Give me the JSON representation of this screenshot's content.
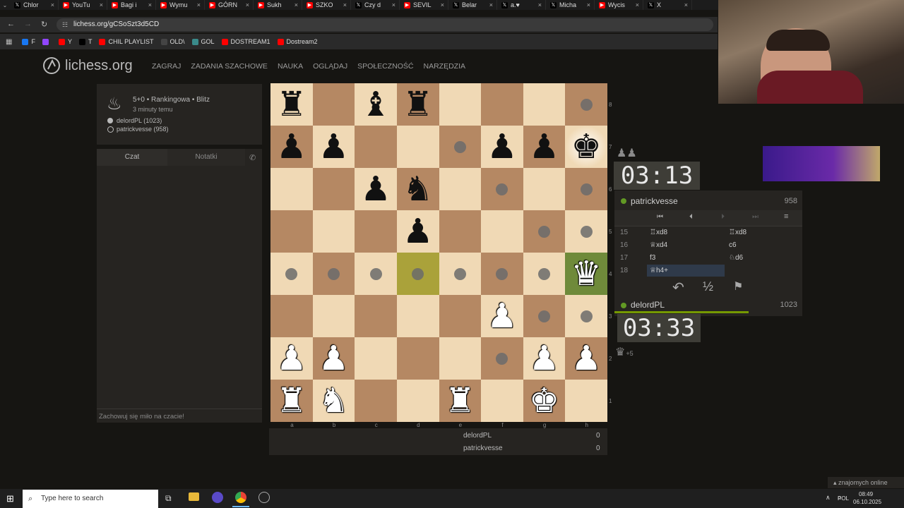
{
  "browser": {
    "tabs": [
      {
        "label": "Chlor",
        "icon": "x-icon",
        "color": "#000000"
      },
      {
        "label": "YouTu",
        "icon": "youtube-icon",
        "color": "#ff0000"
      },
      {
        "label": "Bagi i",
        "icon": "youtube-icon",
        "color": "#ff0000"
      },
      {
        "label": "Wymu",
        "icon": "youtube-icon",
        "color": "#ff0000"
      },
      {
        "label": "GÓRN",
        "icon": "youtube-icon",
        "color": "#ff0000"
      },
      {
        "label": "Sukh",
        "icon": "youtube-icon",
        "color": "#ff0000"
      },
      {
        "label": "SZKO",
        "icon": "youtube-icon",
        "color": "#ff0000"
      },
      {
        "label": "Czy d",
        "icon": "x-icon",
        "color": "#000000"
      },
      {
        "label": "SEVIL",
        "icon": "youtube-icon",
        "color": "#ff0000"
      },
      {
        "label": "Belar",
        "icon": "x-icon",
        "color": "#000000"
      },
      {
        "label": "a.♥",
        "icon": "x-icon",
        "color": "#000000"
      },
      {
        "label": "Micha",
        "icon": "x-icon",
        "color": "#000000"
      },
      {
        "label": "Wycis",
        "icon": "youtube-icon",
        "color": "#ff0000"
      },
      {
        "label": "X",
        "icon": "x-icon",
        "color": "#000000"
      }
    ],
    "url": "lichess.org/gCSoSzt3d5CD",
    "bookmarks": [
      {
        "label": "F",
        "color": "#1877f2"
      },
      {
        "label": "",
        "color": "#9146ff"
      },
      {
        "label": "Y",
        "color": "#ff0000"
      },
      {
        "label": "T",
        "color": "#000000"
      },
      {
        "label": "CHIL PLAYLIST",
        "color": "#ff0000"
      },
      {
        "label": "OLD\\",
        "color": "#444444"
      },
      {
        "label": "GOL",
        "color": "#3a8a8a"
      },
      {
        "label": "DOSTREAM1",
        "color": "#ff0000"
      },
      {
        "label": "Dostream2",
        "color": "#ff0000"
      }
    ]
  },
  "site": {
    "logo_text": "lichess.org",
    "nav": [
      "ZAGRAJ",
      "ZADANIA SZACHOWE",
      "NAUKA",
      "OGLĄDAJ",
      "SPOŁECZNOŚĆ",
      "NARZĘDZIA"
    ]
  },
  "game_info": {
    "format": "5+0 • Rankingowa • Blitz",
    "time_ago": "3 minuty temu",
    "player_white": "delordPL (1023)",
    "player_black": "patrickvesse (958)"
  },
  "chat": {
    "tab_chat": "Czat",
    "tab_notes": "Notatki",
    "footer": "Zachowuj się miło na czacie!"
  },
  "board": {
    "files": [
      "a",
      "b",
      "c",
      "d",
      "e",
      "f",
      "g",
      "h"
    ],
    "ranks": [
      "8",
      "7",
      "6",
      "5",
      "4",
      "3",
      "2",
      "1"
    ],
    "rows": [
      [
        "bR",
        "",
        "bB",
        "bR",
        "",
        "",
        "",
        "."
      ],
      [
        "bP",
        "bP",
        "",
        "",
        ".",
        "bP",
        "bP",
        "bK"
      ],
      [
        "",
        "",
        "bP",
        "bN",
        "",
        ".",
        "",
        "."
      ],
      [
        "",
        "",
        "",
        "bP",
        "",
        "",
        ".",
        "."
      ],
      [
        ".",
        ".",
        ".",
        ".",
        ".",
        ".",
        ".",
        "wQ"
      ],
      [
        "",
        "",
        "",
        "",
        "",
        "wP",
        ".",
        "."
      ],
      [
        "wP",
        "wP",
        "",
        "",
        "",
        ".",
        "wP",
        "wP"
      ],
      [
        "wR",
        "wN",
        "",
        "",
        "wR",
        "",
        "wK",
        ""
      ]
    ]
  },
  "clocks": {
    "top": "03:13",
    "bottom": "03:33"
  },
  "players": {
    "top_name": "patrickvesse",
    "top_rating": "958",
    "bottom_name": "delordPL",
    "bottom_rating": "1023",
    "material_top": "♟♟",
    "material_bottom": "♛",
    "material_bottom_diff": "+5"
  },
  "moves": [
    {
      "no": "15",
      "white": "♖xd8",
      "black": "♖xd8"
    },
    {
      "no": "16",
      "white": "♕xd4",
      "black": "c6"
    },
    {
      "no": "17",
      "white": "f3",
      "black": "♘d6"
    },
    {
      "no": "18",
      "white": "♕h4+",
      "black": ""
    }
  ],
  "controls": {
    "takeback": "↶",
    "draw": "½",
    "resign": "⚑"
  },
  "score": {
    "player1": "delordPL",
    "score1": "0",
    "player2": "patrickvesse",
    "score2": "0"
  },
  "friends_online": "znajomych online",
  "taskbar": {
    "search_placeholder": "Type here to search",
    "language": "POL",
    "time": "08:49",
    "date": "06.10.2025"
  }
}
